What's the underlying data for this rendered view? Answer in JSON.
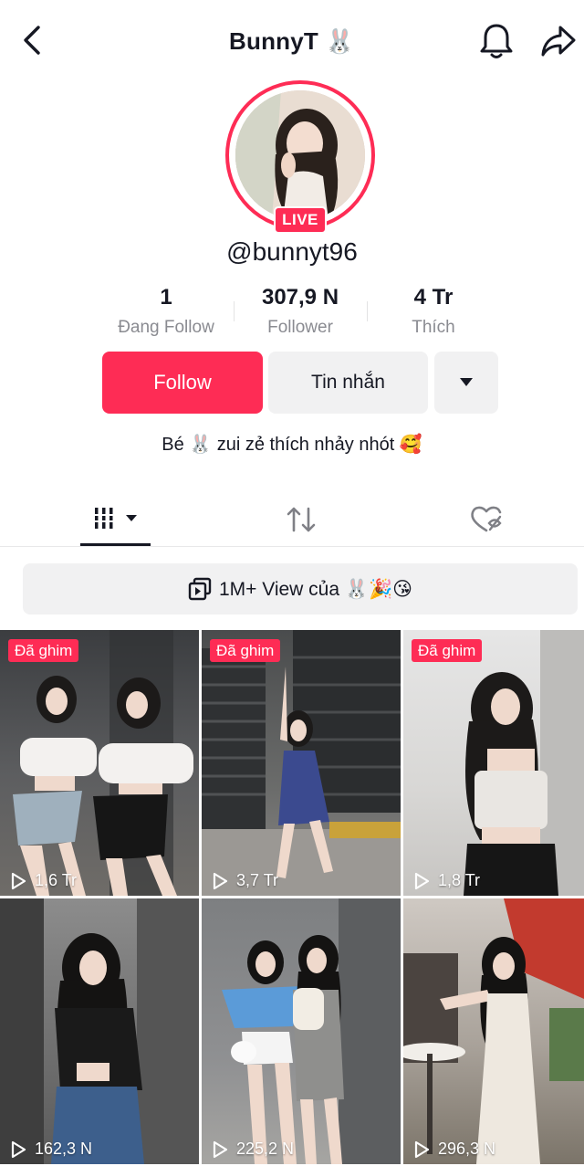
{
  "header": {
    "title": "BunnyT 🐰"
  },
  "profile": {
    "live_label": "LIVE",
    "handle": "@bunnyt96",
    "bio": "Bé 🐰 zui zẻ thích nhảy nhót 🥰"
  },
  "stats": [
    {
      "value": "1",
      "label": "Đang Follow"
    },
    {
      "value": "307,9 N",
      "label": "Follower"
    },
    {
      "value": "4 Tr",
      "label": "Thích"
    }
  ],
  "actions": {
    "follow_label": "Follow",
    "message_label": "Tin nhắn"
  },
  "tabs": {
    "active_index": 0,
    "icons": [
      "videos-grid-icon",
      "repost-icon",
      "liked-hidden-icon"
    ]
  },
  "promo": {
    "label": "1M+ View của 🐰🎉😘"
  },
  "videos": [
    {
      "pinned_label": "Đã ghim",
      "views": "1,6 Tr"
    },
    {
      "pinned_label": "Đã ghim",
      "views": "3,7 Tr"
    },
    {
      "pinned_label": "Đã ghim",
      "views": "1,8 Tr"
    },
    {
      "pinned_label": "",
      "views": "162,3 N"
    },
    {
      "pinned_label": "",
      "views": "225,2 N"
    },
    {
      "pinned_label": "",
      "views": "296,3 N"
    }
  ],
  "colors": {
    "accent": "#fe2c55",
    "text": "#161823",
    "muted": "#8a8b91",
    "button_bg": "#f1f1f2"
  }
}
